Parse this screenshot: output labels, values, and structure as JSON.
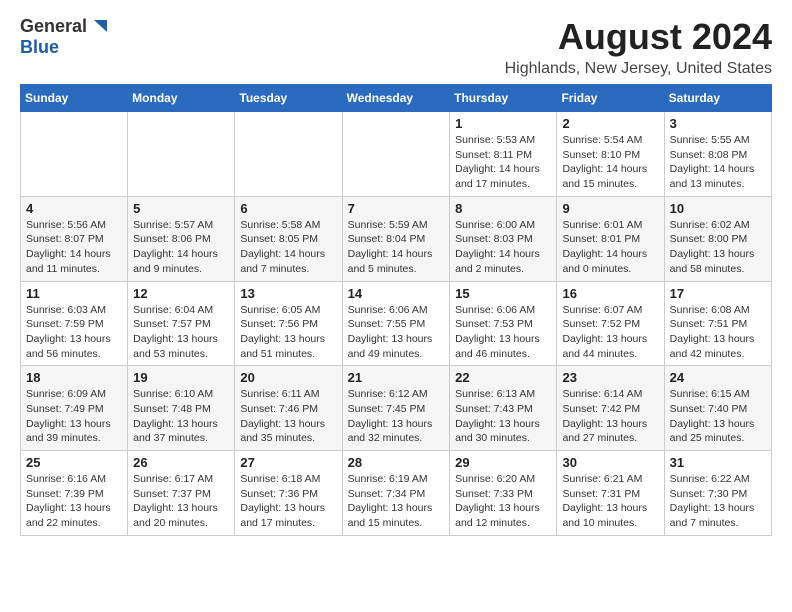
{
  "logo": {
    "general": "General",
    "blue": "Blue"
  },
  "title": "August 2024",
  "subtitle": "Highlands, New Jersey, United States",
  "headers": [
    "Sunday",
    "Monday",
    "Tuesday",
    "Wednesday",
    "Thursday",
    "Friday",
    "Saturday"
  ],
  "weeks": [
    [
      {
        "day": "",
        "info": ""
      },
      {
        "day": "",
        "info": ""
      },
      {
        "day": "",
        "info": ""
      },
      {
        "day": "",
        "info": ""
      },
      {
        "day": "1",
        "info": "Sunrise: 5:53 AM\nSunset: 8:11 PM\nDaylight: 14 hours and 17 minutes."
      },
      {
        "day": "2",
        "info": "Sunrise: 5:54 AM\nSunset: 8:10 PM\nDaylight: 14 hours and 15 minutes."
      },
      {
        "day": "3",
        "info": "Sunrise: 5:55 AM\nSunset: 8:08 PM\nDaylight: 14 hours and 13 minutes."
      }
    ],
    [
      {
        "day": "4",
        "info": "Sunrise: 5:56 AM\nSunset: 8:07 PM\nDaylight: 14 hours and 11 minutes."
      },
      {
        "day": "5",
        "info": "Sunrise: 5:57 AM\nSunset: 8:06 PM\nDaylight: 14 hours and 9 minutes."
      },
      {
        "day": "6",
        "info": "Sunrise: 5:58 AM\nSunset: 8:05 PM\nDaylight: 14 hours and 7 minutes."
      },
      {
        "day": "7",
        "info": "Sunrise: 5:59 AM\nSunset: 8:04 PM\nDaylight: 14 hours and 5 minutes."
      },
      {
        "day": "8",
        "info": "Sunrise: 6:00 AM\nSunset: 8:03 PM\nDaylight: 14 hours and 2 minutes."
      },
      {
        "day": "9",
        "info": "Sunrise: 6:01 AM\nSunset: 8:01 PM\nDaylight: 14 hours and 0 minutes."
      },
      {
        "day": "10",
        "info": "Sunrise: 6:02 AM\nSunset: 8:00 PM\nDaylight: 13 hours and 58 minutes."
      }
    ],
    [
      {
        "day": "11",
        "info": "Sunrise: 6:03 AM\nSunset: 7:59 PM\nDaylight: 13 hours and 56 minutes."
      },
      {
        "day": "12",
        "info": "Sunrise: 6:04 AM\nSunset: 7:57 PM\nDaylight: 13 hours and 53 minutes."
      },
      {
        "day": "13",
        "info": "Sunrise: 6:05 AM\nSunset: 7:56 PM\nDaylight: 13 hours and 51 minutes."
      },
      {
        "day": "14",
        "info": "Sunrise: 6:06 AM\nSunset: 7:55 PM\nDaylight: 13 hours and 49 minutes."
      },
      {
        "day": "15",
        "info": "Sunrise: 6:06 AM\nSunset: 7:53 PM\nDaylight: 13 hours and 46 minutes."
      },
      {
        "day": "16",
        "info": "Sunrise: 6:07 AM\nSunset: 7:52 PM\nDaylight: 13 hours and 44 minutes."
      },
      {
        "day": "17",
        "info": "Sunrise: 6:08 AM\nSunset: 7:51 PM\nDaylight: 13 hours and 42 minutes."
      }
    ],
    [
      {
        "day": "18",
        "info": "Sunrise: 6:09 AM\nSunset: 7:49 PM\nDaylight: 13 hours and 39 minutes."
      },
      {
        "day": "19",
        "info": "Sunrise: 6:10 AM\nSunset: 7:48 PM\nDaylight: 13 hours and 37 minutes."
      },
      {
        "day": "20",
        "info": "Sunrise: 6:11 AM\nSunset: 7:46 PM\nDaylight: 13 hours and 35 minutes."
      },
      {
        "day": "21",
        "info": "Sunrise: 6:12 AM\nSunset: 7:45 PM\nDaylight: 13 hours and 32 minutes."
      },
      {
        "day": "22",
        "info": "Sunrise: 6:13 AM\nSunset: 7:43 PM\nDaylight: 13 hours and 30 minutes."
      },
      {
        "day": "23",
        "info": "Sunrise: 6:14 AM\nSunset: 7:42 PM\nDaylight: 13 hours and 27 minutes."
      },
      {
        "day": "24",
        "info": "Sunrise: 6:15 AM\nSunset: 7:40 PM\nDaylight: 13 hours and 25 minutes."
      }
    ],
    [
      {
        "day": "25",
        "info": "Sunrise: 6:16 AM\nSunset: 7:39 PM\nDaylight: 13 hours and 22 minutes."
      },
      {
        "day": "26",
        "info": "Sunrise: 6:17 AM\nSunset: 7:37 PM\nDaylight: 13 hours and 20 minutes."
      },
      {
        "day": "27",
        "info": "Sunrise: 6:18 AM\nSunset: 7:36 PM\nDaylight: 13 hours and 17 minutes."
      },
      {
        "day": "28",
        "info": "Sunrise: 6:19 AM\nSunset: 7:34 PM\nDaylight: 13 hours and 15 minutes."
      },
      {
        "day": "29",
        "info": "Sunrise: 6:20 AM\nSunset: 7:33 PM\nDaylight: 13 hours and 12 minutes."
      },
      {
        "day": "30",
        "info": "Sunrise: 6:21 AM\nSunset: 7:31 PM\nDaylight: 13 hours and 10 minutes."
      },
      {
        "day": "31",
        "info": "Sunrise: 6:22 AM\nSunset: 7:30 PM\nDaylight: 13 hours and 7 minutes."
      }
    ]
  ]
}
